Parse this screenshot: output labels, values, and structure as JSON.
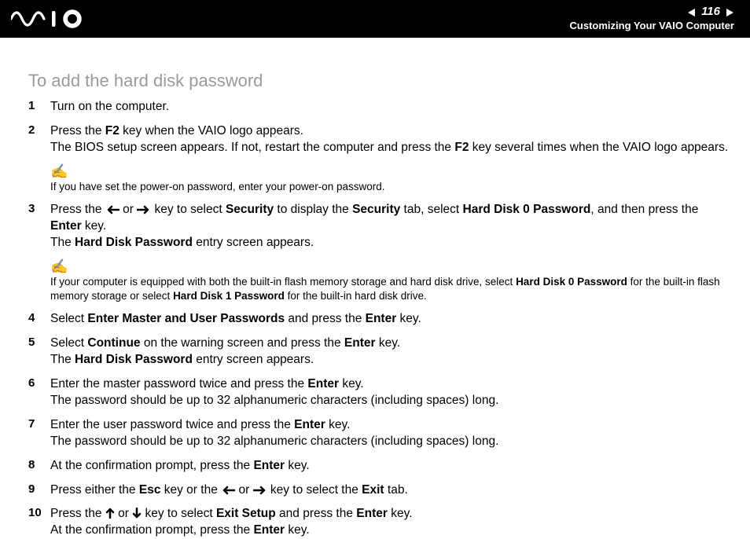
{
  "header": {
    "page_number": "116",
    "section": "Customizing Your VAIO Computer"
  },
  "title": "To add the hard disk password",
  "steps": {
    "s1": {
      "num": "1",
      "t1": "Turn on the computer."
    },
    "s2": {
      "num": "2",
      "t1": "Press the ",
      "b1": "F2",
      "t2": " key when the VAIO logo appears.",
      "t3": "The BIOS setup screen appears. If not, restart the computer and press the ",
      "b2": "F2",
      "t4": " key several times when the VAIO logo appears."
    },
    "note1": {
      "t1": "If you have set the power-on password, enter your power-on password."
    },
    "s3": {
      "num": "3",
      "t1": "Press the ",
      "t2": " or ",
      "t3": " key to select ",
      "b1": "Security",
      "t4": " to display the ",
      "b2": "Security",
      "t5": " tab, select ",
      "b3": "Hard Disk 0 Password",
      "t6": ", and then press the ",
      "b4": "Enter",
      "t7": " key.",
      "t8": "The ",
      "b5": "Hard Disk Password",
      "t9": " entry screen appears."
    },
    "note2": {
      "t1": "If your computer is equipped with both the built-in flash memory storage and hard disk drive, select ",
      "b1": "Hard Disk 0 Password",
      "t2": " for the built-in flash memory storage or select ",
      "b2": "Hard Disk 1 Password",
      "t3": " for the built-in hard disk drive."
    },
    "s4": {
      "num": "4",
      "t1": "Select ",
      "b1": "Enter Master and User Passwords",
      "t2": " and press the ",
      "b2": "Enter",
      "t3": " key."
    },
    "s5": {
      "num": "5",
      "t1": "Select ",
      "b1": "Continue",
      "t2": " on the warning screen and press the ",
      "b2": "Enter",
      "t3": " key.",
      "t4": "The ",
      "b3": "Hard Disk Password",
      "t5": " entry screen appears."
    },
    "s6": {
      "num": "6",
      "t1": "Enter the master password twice and press the ",
      "b1": "Enter",
      "t2": " key.",
      "t3": "The password should be up to 32 alphanumeric characters (including spaces) long."
    },
    "s7": {
      "num": "7",
      "t1": "Enter the user password twice and press the ",
      "b1": "Enter",
      "t2": " key.",
      "t3": "The password should be up to 32 alphanumeric characters (including spaces) long."
    },
    "s8": {
      "num": "8",
      "t1": "At the confirmation prompt, press the ",
      "b1": "Enter",
      "t2": " key."
    },
    "s9": {
      "num": "9",
      "t1": "Press either the ",
      "b1": "Esc",
      "t2": " key or the ",
      "t3": " or ",
      "t4": " key to select the ",
      "b2": "Exit",
      "t5": " tab."
    },
    "s10": {
      "num": "10",
      "t1": "Press the ",
      "t2": " or ",
      "t3": " key to select ",
      "b1": "Exit Setup",
      "t4": " and press the ",
      "b2": "Enter",
      "t5": " key.",
      "t6": "At the confirmation prompt, press the ",
      "b3": "Enter",
      "t7": " key."
    }
  }
}
